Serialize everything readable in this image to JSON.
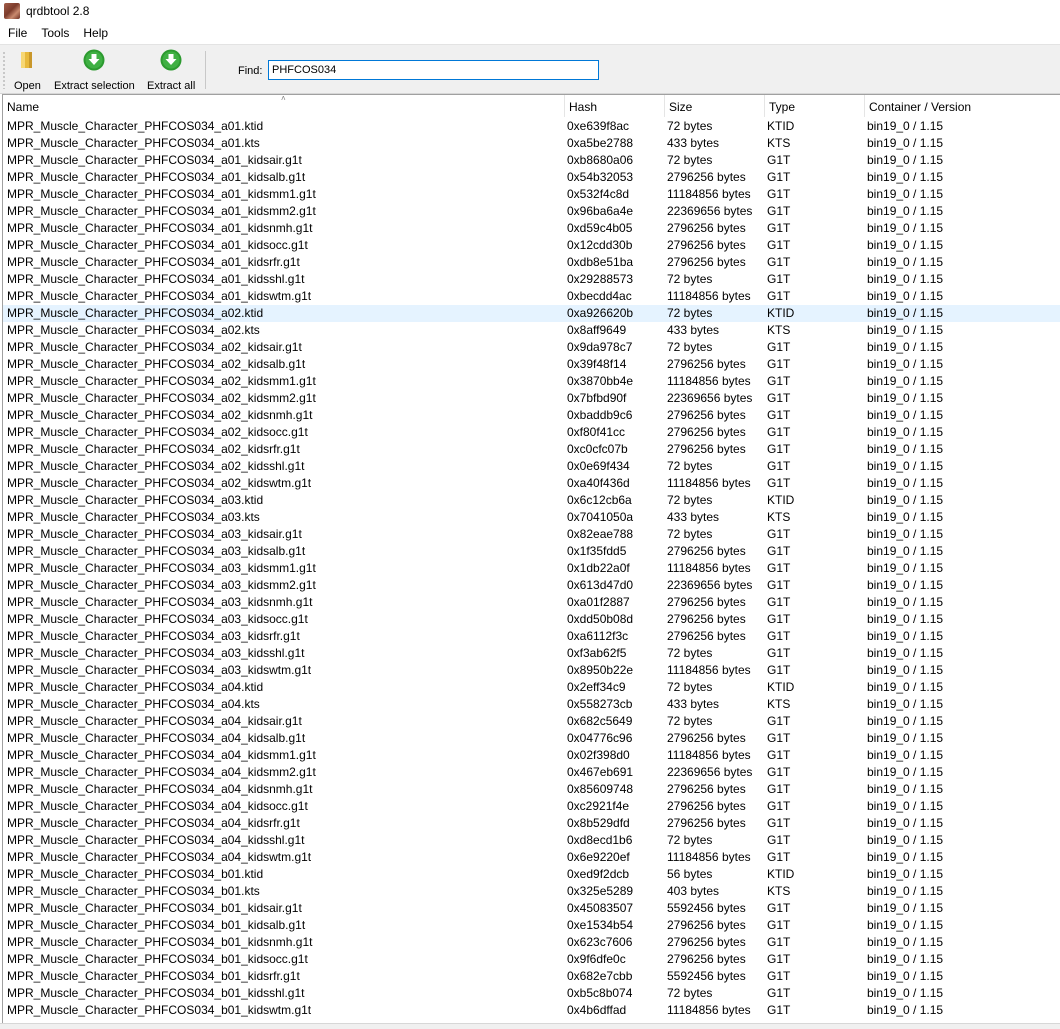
{
  "window": {
    "title": "qrdbtool 2.8"
  },
  "menu": [
    "File",
    "Tools",
    "Help"
  ],
  "toolbar": {
    "open_label": "Open",
    "extract_selection_label": "Extract selection",
    "extract_all_label": "Extract all",
    "find_label": "Find:",
    "find_value": "PHFCOS034"
  },
  "colors": {
    "selected_row": "#e5f3ff",
    "toolbar_bg": "#f0f0f0",
    "download_icon": "#2c9a2f",
    "folder_icon": "#e8b93c",
    "find_border": "#0078d7"
  },
  "columns": [
    "Name",
    "Hash",
    "Size",
    "Type",
    "Container / Version"
  ],
  "selected_row_index": 11,
  "rows": [
    [
      "MPR_Muscle_Character_PHFCOS034_a01.ktid",
      "0xe639f8ac",
      "72 bytes",
      "KTID",
      "bin19_0 / 1.15"
    ],
    [
      "MPR_Muscle_Character_PHFCOS034_a01.kts",
      "0xa5be2788",
      "433 bytes",
      "KTS",
      "bin19_0 / 1.15"
    ],
    [
      "MPR_Muscle_Character_PHFCOS034_a01_kidsair.g1t",
      "0xb8680a06",
      "72 bytes",
      "G1T",
      "bin19_0 / 1.15"
    ],
    [
      "MPR_Muscle_Character_PHFCOS034_a01_kidsalb.g1t",
      "0x54b32053",
      "2796256 bytes",
      "G1T",
      "bin19_0 / 1.15"
    ],
    [
      "MPR_Muscle_Character_PHFCOS034_a01_kidsmm1.g1t",
      "0x532f4c8d",
      "11184856 bytes",
      "G1T",
      "bin19_0 / 1.15"
    ],
    [
      "MPR_Muscle_Character_PHFCOS034_a01_kidsmm2.g1t",
      "0x96ba6a4e",
      "22369656 bytes",
      "G1T",
      "bin19_0 / 1.15"
    ],
    [
      "MPR_Muscle_Character_PHFCOS034_a01_kidsnmh.g1t",
      "0xd59c4b05",
      "2796256 bytes",
      "G1T",
      "bin19_0 / 1.15"
    ],
    [
      "MPR_Muscle_Character_PHFCOS034_a01_kidsocc.g1t",
      "0x12cdd30b",
      "2796256 bytes",
      "G1T",
      "bin19_0 / 1.15"
    ],
    [
      "MPR_Muscle_Character_PHFCOS034_a01_kidsrfr.g1t",
      "0xdb8e51ba",
      "2796256 bytes",
      "G1T",
      "bin19_0 / 1.15"
    ],
    [
      "MPR_Muscle_Character_PHFCOS034_a01_kidsshl.g1t",
      "0x29288573",
      "72 bytes",
      "G1T",
      "bin19_0 / 1.15"
    ],
    [
      "MPR_Muscle_Character_PHFCOS034_a01_kidswtm.g1t",
      "0xbecdd4ac",
      "11184856 bytes",
      "G1T",
      "bin19_0 / 1.15"
    ],
    [
      "MPR_Muscle_Character_PHFCOS034_a02.ktid",
      "0xa926620b",
      "72 bytes",
      "KTID",
      "bin19_0 / 1.15"
    ],
    [
      "MPR_Muscle_Character_PHFCOS034_a02.kts",
      "0x8aff9649",
      "433 bytes",
      "KTS",
      "bin19_0 / 1.15"
    ],
    [
      "MPR_Muscle_Character_PHFCOS034_a02_kidsair.g1t",
      "0x9da978c7",
      "72 bytes",
      "G1T",
      "bin19_0 / 1.15"
    ],
    [
      "MPR_Muscle_Character_PHFCOS034_a02_kidsalb.g1t",
      "0x39f48f14",
      "2796256 bytes",
      "G1T",
      "bin19_0 / 1.15"
    ],
    [
      "MPR_Muscle_Character_PHFCOS034_a02_kidsmm1.g1t",
      "0x3870bb4e",
      "11184856 bytes",
      "G1T",
      "bin19_0 / 1.15"
    ],
    [
      "MPR_Muscle_Character_PHFCOS034_a02_kidsmm2.g1t",
      "0x7bfbd90f",
      "22369656 bytes",
      "G1T",
      "bin19_0 / 1.15"
    ],
    [
      "MPR_Muscle_Character_PHFCOS034_a02_kidsnmh.g1t",
      "0xbaddb9c6",
      "2796256 bytes",
      "G1T",
      "bin19_0 / 1.15"
    ],
    [
      "MPR_Muscle_Character_PHFCOS034_a02_kidsocc.g1t",
      "0xf80f41cc",
      "2796256 bytes",
      "G1T",
      "bin19_0 / 1.15"
    ],
    [
      "MPR_Muscle_Character_PHFCOS034_a02_kidsrfr.g1t",
      "0xc0cfc07b",
      "2796256 bytes",
      "G1T",
      "bin19_0 / 1.15"
    ],
    [
      "MPR_Muscle_Character_PHFCOS034_a02_kidsshl.g1t",
      "0x0e69f434",
      "72 bytes",
      "G1T",
      "bin19_0 / 1.15"
    ],
    [
      "MPR_Muscle_Character_PHFCOS034_a02_kidswtm.g1t",
      "0xa40f436d",
      "11184856 bytes",
      "G1T",
      "bin19_0 / 1.15"
    ],
    [
      "MPR_Muscle_Character_PHFCOS034_a03.ktid",
      "0x6c12cb6a",
      "72 bytes",
      "KTID",
      "bin19_0 / 1.15"
    ],
    [
      "MPR_Muscle_Character_PHFCOS034_a03.kts",
      "0x7041050a",
      "433 bytes",
      "KTS",
      "bin19_0 / 1.15"
    ],
    [
      "MPR_Muscle_Character_PHFCOS034_a03_kidsair.g1t",
      "0x82eae788",
      "72 bytes",
      "G1T",
      "bin19_0 / 1.15"
    ],
    [
      "MPR_Muscle_Character_PHFCOS034_a03_kidsalb.g1t",
      "0x1f35fdd5",
      "2796256 bytes",
      "G1T",
      "bin19_0 / 1.15"
    ],
    [
      "MPR_Muscle_Character_PHFCOS034_a03_kidsmm1.g1t",
      "0x1db22a0f",
      "11184856 bytes",
      "G1T",
      "bin19_0 / 1.15"
    ],
    [
      "MPR_Muscle_Character_PHFCOS034_a03_kidsmm2.g1t",
      "0x613d47d0",
      "22369656 bytes",
      "G1T",
      "bin19_0 / 1.15"
    ],
    [
      "MPR_Muscle_Character_PHFCOS034_a03_kidsnmh.g1t",
      "0xa01f2887",
      "2796256 bytes",
      "G1T",
      "bin19_0 / 1.15"
    ],
    [
      "MPR_Muscle_Character_PHFCOS034_a03_kidsocc.g1t",
      "0xdd50b08d",
      "2796256 bytes",
      "G1T",
      "bin19_0 / 1.15"
    ],
    [
      "MPR_Muscle_Character_PHFCOS034_a03_kidsrfr.g1t",
      "0xa6112f3c",
      "2796256 bytes",
      "G1T",
      "bin19_0 / 1.15"
    ],
    [
      "MPR_Muscle_Character_PHFCOS034_a03_kidsshl.g1t",
      "0xf3ab62f5",
      "72 bytes",
      "G1T",
      "bin19_0 / 1.15"
    ],
    [
      "MPR_Muscle_Character_PHFCOS034_a03_kidswtm.g1t",
      "0x8950b22e",
      "11184856 bytes",
      "G1T",
      "bin19_0 / 1.15"
    ],
    [
      "MPR_Muscle_Character_PHFCOS034_a04.ktid",
      "0x2eff34c9",
      "72 bytes",
      "KTID",
      "bin19_0 / 1.15"
    ],
    [
      "MPR_Muscle_Character_PHFCOS034_a04.kts",
      "0x558273cb",
      "433 bytes",
      "KTS",
      "bin19_0 / 1.15"
    ],
    [
      "MPR_Muscle_Character_PHFCOS034_a04_kidsair.g1t",
      "0x682c5649",
      "72 bytes",
      "G1T",
      "bin19_0 / 1.15"
    ],
    [
      "MPR_Muscle_Character_PHFCOS034_a04_kidsalb.g1t",
      "0x04776c96",
      "2796256 bytes",
      "G1T",
      "bin19_0 / 1.15"
    ],
    [
      "MPR_Muscle_Character_PHFCOS034_a04_kidsmm1.g1t",
      "0x02f398d0",
      "11184856 bytes",
      "G1T",
      "bin19_0 / 1.15"
    ],
    [
      "MPR_Muscle_Character_PHFCOS034_a04_kidsmm2.g1t",
      "0x467eb691",
      "22369656 bytes",
      "G1T",
      "bin19_0 / 1.15"
    ],
    [
      "MPR_Muscle_Character_PHFCOS034_a04_kidsnmh.g1t",
      "0x85609748",
      "2796256 bytes",
      "G1T",
      "bin19_0 / 1.15"
    ],
    [
      "MPR_Muscle_Character_PHFCOS034_a04_kidsocc.g1t",
      "0xc2921f4e",
      "2796256 bytes",
      "G1T",
      "bin19_0 / 1.15"
    ],
    [
      "MPR_Muscle_Character_PHFCOS034_a04_kidsrfr.g1t",
      "0x8b529dfd",
      "2796256 bytes",
      "G1T",
      "bin19_0 / 1.15"
    ],
    [
      "MPR_Muscle_Character_PHFCOS034_a04_kidsshl.g1t",
      "0xd8ecd1b6",
      "72 bytes",
      "G1T",
      "bin19_0 / 1.15"
    ],
    [
      "MPR_Muscle_Character_PHFCOS034_a04_kidswtm.g1t",
      "0x6e9220ef",
      "11184856 bytes",
      "G1T",
      "bin19_0 / 1.15"
    ],
    [
      "MPR_Muscle_Character_PHFCOS034_b01.ktid",
      "0xed9f2dcb",
      "56 bytes",
      "KTID",
      "bin19_0 / 1.15"
    ],
    [
      "MPR_Muscle_Character_PHFCOS034_b01.kts",
      "0x325e5289",
      "403 bytes",
      "KTS",
      "bin19_0 / 1.15"
    ],
    [
      "MPR_Muscle_Character_PHFCOS034_b01_kidsair.g1t",
      "0x45083507",
      "5592456 bytes",
      "G1T",
      "bin19_0 / 1.15"
    ],
    [
      "MPR_Muscle_Character_PHFCOS034_b01_kidsalb.g1t",
      "0xe1534b54",
      "2796256 bytes",
      "G1T",
      "bin19_0 / 1.15"
    ],
    [
      "MPR_Muscle_Character_PHFCOS034_b01_kidsnmh.g1t",
      "0x623c7606",
      "2796256 bytes",
      "G1T",
      "bin19_0 / 1.15"
    ],
    [
      "MPR_Muscle_Character_PHFCOS034_b01_kidsocc.g1t",
      "0x9f6dfe0c",
      "2796256 bytes",
      "G1T",
      "bin19_0 / 1.15"
    ],
    [
      "MPR_Muscle_Character_PHFCOS034_b01_kidsrfr.g1t",
      "0x682e7cbb",
      "5592456 bytes",
      "G1T",
      "bin19_0 / 1.15"
    ],
    [
      "MPR_Muscle_Character_PHFCOS034_b01_kidsshl.g1t",
      "0xb5c8b074",
      "72 bytes",
      "G1T",
      "bin19_0 / 1.15"
    ],
    [
      "MPR_Muscle_Character_PHFCOS034_b01_kidswtm.g1t",
      "0x4b6dffad",
      "11184856 bytes",
      "G1T",
      "bin19_0 / 1.15"
    ]
  ]
}
